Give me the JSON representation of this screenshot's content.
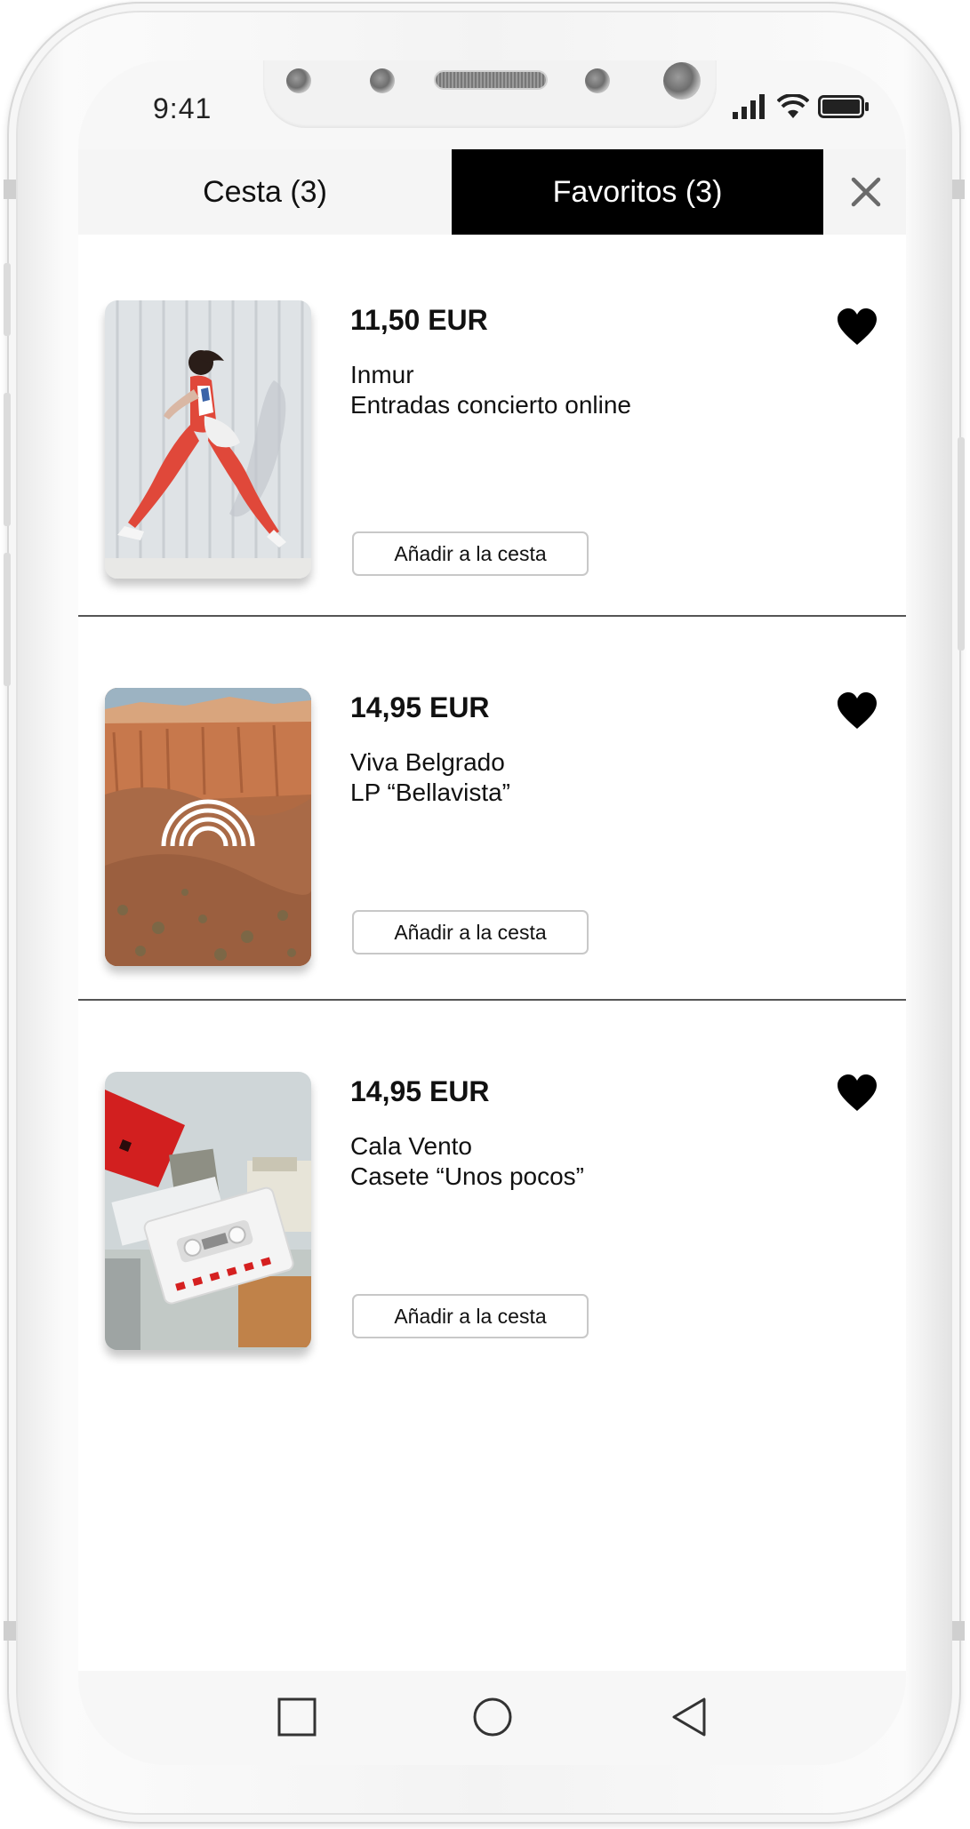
{
  "status_bar": {
    "time": "9:41",
    "icons": [
      "signal-icon",
      "wifi-icon",
      "battery-icon"
    ]
  },
  "tabs": [
    {
      "label": "Cesta (3)",
      "active": false
    },
    {
      "label": "Favoritos (3)",
      "active": true
    }
  ],
  "close_icon": "close-icon",
  "items": [
    {
      "price": "11,50 EUR",
      "artist": "Inmur",
      "product": "Entradas concierto online",
      "button_label": "Añadir a la cesta",
      "favorite": true,
      "image": "photo of a woman in red and white running outfit striding past a white corrugated wall"
    },
    {
      "price": "14,95 EUR",
      "artist": "Viva Belgrado",
      "product": "LP “Bellavista”",
      "button_label": "Añadir a la cesta",
      "favorite": true,
      "image": "desert canyon landscape with a white rainbow arch logo overlay"
    },
    {
      "price": "14,95 EUR",
      "artist": "Cala Vento",
      "product": "Casete “Unos pocos”",
      "button_label": "Añadir a la cesta",
      "favorite": true,
      "image": "white cassette tape with red case and printed inserts on a table"
    }
  ],
  "nav": [
    "square-icon",
    "circle-icon",
    "back-triangle-icon"
  ],
  "colors": {
    "active_tab_bg": "#000000",
    "active_tab_text": "#ffffff",
    "divider": "#555555"
  }
}
